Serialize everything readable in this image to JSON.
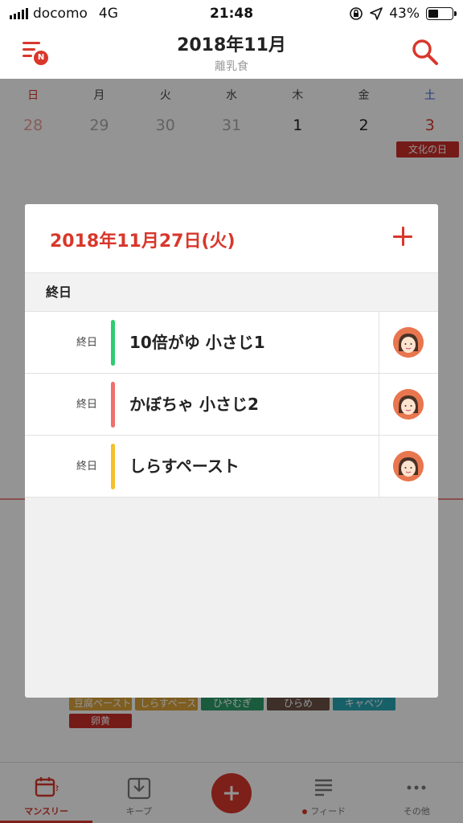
{
  "status_bar": {
    "carrier": "docomo",
    "network": "4G",
    "time": "21:48",
    "battery_percent": "43%",
    "battery_level": 0.43
  },
  "header": {
    "title": "2018年11月",
    "subtitle": "離乳食",
    "menu_badge": "N"
  },
  "calendar": {
    "weekdays": [
      "日",
      "月",
      "火",
      "水",
      "木",
      "金",
      "土"
    ],
    "dates": [
      "28",
      "29",
      "30",
      "31",
      "1",
      "2",
      "3"
    ],
    "holiday": "文化の日",
    "tags_row1": [
      {
        "label": "豆腐ペースト",
        "color": "#d9a23a"
      },
      {
        "label": "しらすペース",
        "color": "#d9a23a"
      },
      {
        "label": "ひやむぎ",
        "color": "#2e9e6a"
      },
      {
        "label": "ひらめ",
        "color": "#6b5145"
      },
      {
        "label": "キャベツ",
        "color": "#2aa6b3"
      }
    ],
    "tags_row2": [
      {
        "label": "卵黄",
        "color": "#c8302a"
      }
    ]
  },
  "popup": {
    "date": "2018年11月27日(火)",
    "section": "終日",
    "events": [
      {
        "time": "終日",
        "title": "10倍がゆ 小さじ1",
        "color": "#2ecc71"
      },
      {
        "time": "終日",
        "title": "かぼちゃ 小さじ2",
        "color": "#f0706a"
      },
      {
        "time": "終日",
        "title": "しらすペースト",
        "color": "#f5c02a"
      }
    ]
  },
  "tabs": {
    "monthly": "マンスリー",
    "keep": "キープ",
    "feed": "フィード",
    "other": "その他"
  },
  "colors": {
    "accent": "#d8372c"
  }
}
